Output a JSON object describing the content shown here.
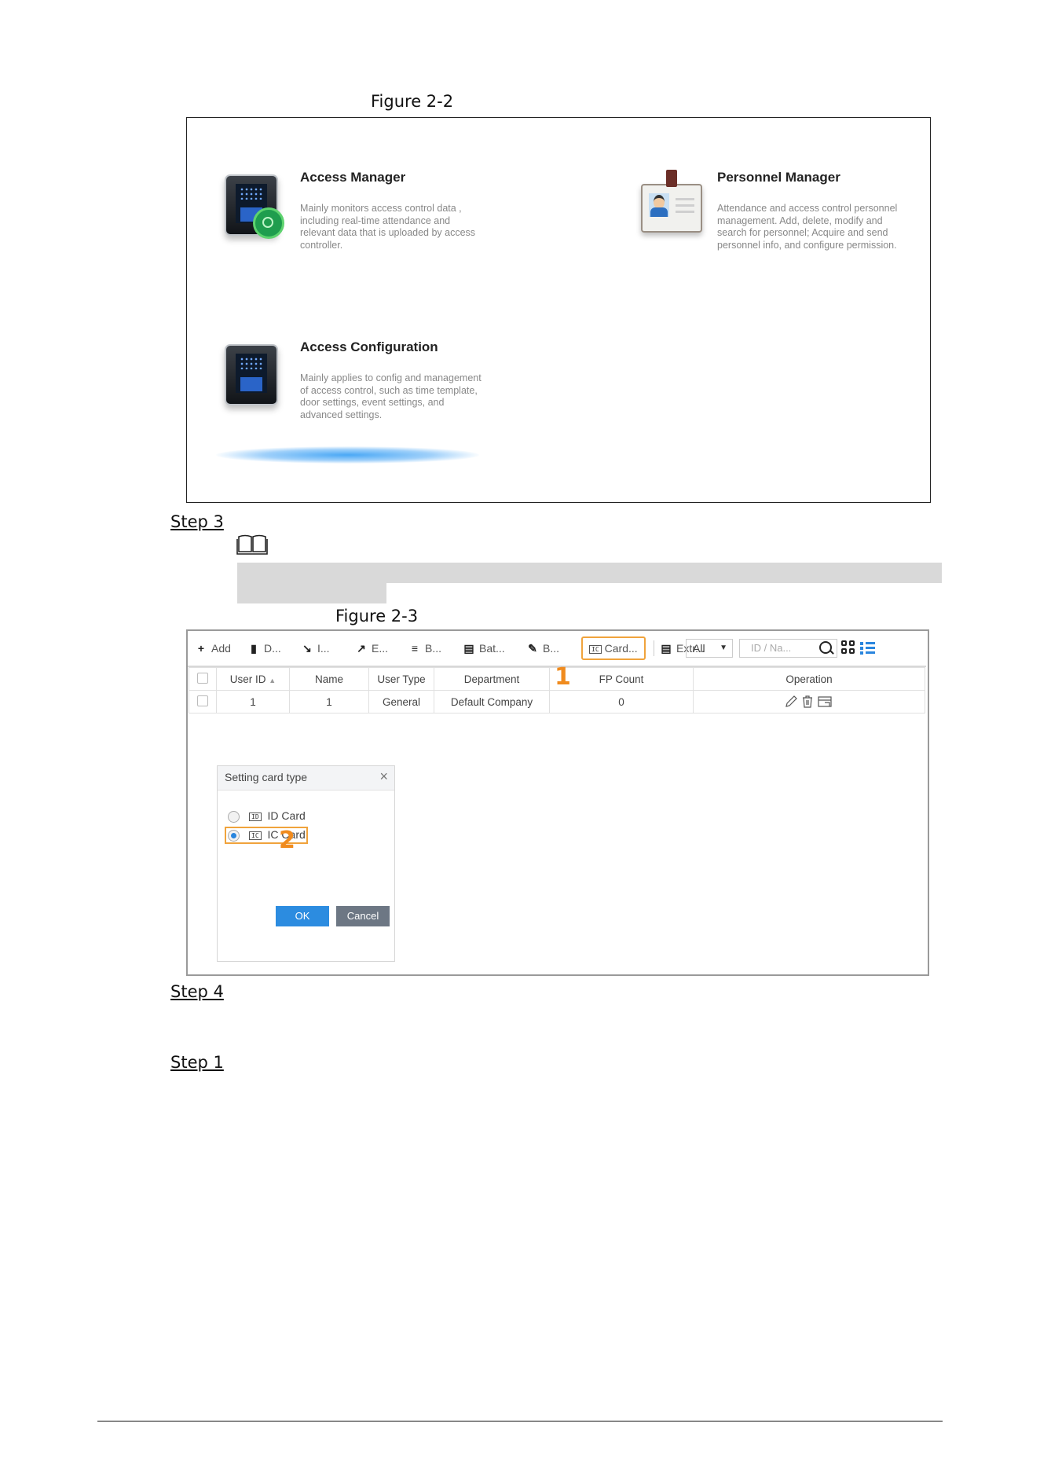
{
  "figure_2_2": {
    "caption": "Figure 2-2",
    "apps": [
      {
        "title": "Access Manager",
        "description": "Mainly monitors access control data , including real-time attendance and relevant data that is uploaded by access controller.",
        "icon": "access-manager-icon"
      },
      {
        "title": "Personnel Manager",
        "description": "Attendance and access control personnel management.  Add, delete, modify and search for personnel; Acquire and send personnel info, and configure permission.",
        "icon": "personnel-manager-icon"
      },
      {
        "title": "Access Configuration",
        "description": "Mainly applies to config and management of access control, such as time template, door settings, event settings, and advanced settings.",
        "icon": "access-configuration-icon"
      }
    ]
  },
  "steps": {
    "step3": "Step 3",
    "step4": "Step 4",
    "step1": "Step 1"
  },
  "note_icon": "book-icon",
  "figure_2_3": {
    "caption": "Figure 2-3",
    "toolbar": {
      "add": "Add",
      "delete": "D...",
      "import": "I...",
      "export": "E...",
      "batch_b": "B...",
      "batch": "Bat...",
      "edit_b": "B...",
      "card": "Card...",
      "card_icon_text": "IC",
      "extract": "Extr...",
      "filter_value": "All",
      "search_placeholder": "ID / Na..."
    },
    "table": {
      "columns": [
        "User ID",
        "Name",
        "User Type",
        "Department",
        "FP Count",
        "Operation"
      ],
      "rows": [
        {
          "user_id": "1",
          "name": "1",
          "user_type": "General",
          "department": "Default Company",
          "fp_count": "0"
        }
      ]
    },
    "markers": {
      "one": "1",
      "two": "2"
    },
    "dialog": {
      "title": "Setting card type",
      "options": [
        {
          "icon_text": "ID",
          "label": "ID Card",
          "selected": false
        },
        {
          "icon_text": "IC",
          "label": "IC Card",
          "selected": true
        }
      ],
      "ok": "OK",
      "cancel": "Cancel"
    },
    "colors": {
      "accent": "#2c8ce0",
      "highlight": "#f0a33c",
      "marker": "#f08b1e"
    }
  }
}
